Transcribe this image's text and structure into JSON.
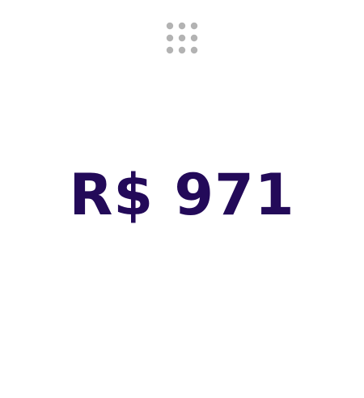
{
  "app_menu": {
    "icon": "grid-icon",
    "dot_color": "#b3b3b3"
  },
  "price": {
    "amount_text": "R$ 971",
    "color": "#230a59"
  }
}
